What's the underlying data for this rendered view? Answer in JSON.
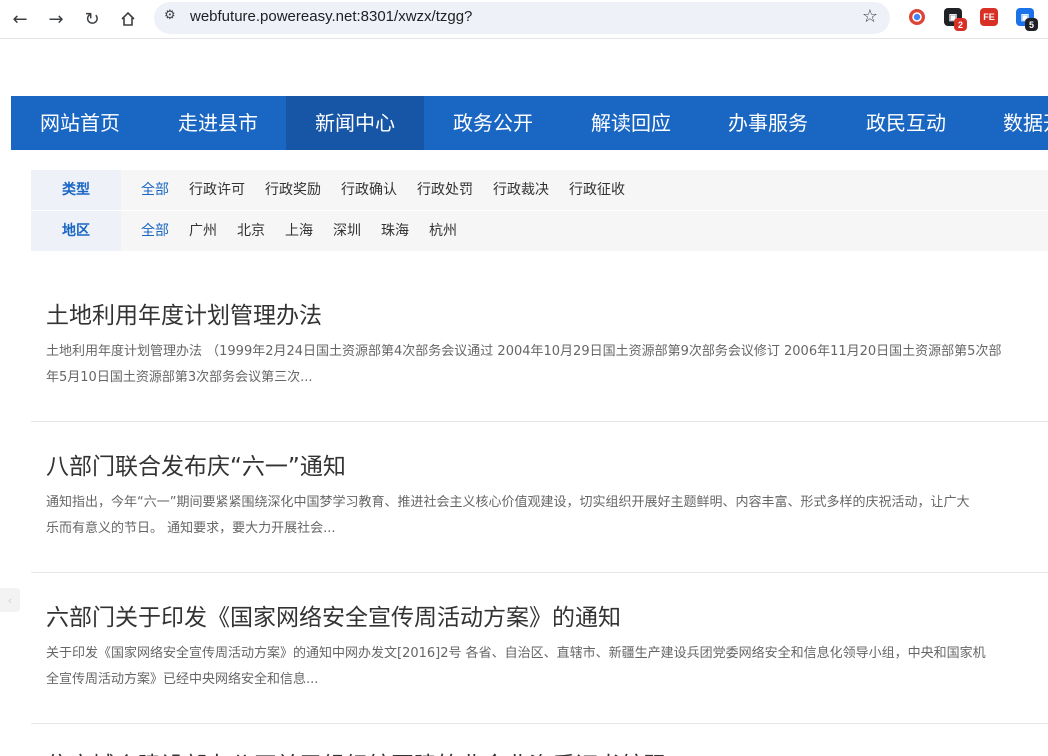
{
  "browser": {
    "url": "webfuture.powereasy.net:8301/xwzx/tzgg?",
    "extensions": [
      {
        "name": "chrome-extension-icon",
        "label": "",
        "color": "#db4437"
      },
      {
        "name": "extension-badge-2-icon",
        "label": "",
        "color": "#202124",
        "badge": "2",
        "badge_color": "#d93025"
      },
      {
        "name": "fe-extension-icon",
        "label": "FE",
        "color": "#d93025"
      },
      {
        "name": "extension-badge-5-icon",
        "label": "",
        "color": "#1a73e8",
        "badge": "5",
        "badge_color": "#202124"
      }
    ]
  },
  "nav": {
    "items": [
      "网站首页",
      "走进县市",
      "新闻中心",
      "政务公开",
      "解读回应",
      "办事服务",
      "政民互动",
      "数据开放"
    ],
    "active_index": 2
  },
  "filters": {
    "type": {
      "label": "类型",
      "options": [
        "全部",
        "行政许可",
        "行政奖励",
        "行政确认",
        "行政处罚",
        "行政裁决",
        "行政征收"
      ],
      "selected_index": 0
    },
    "region": {
      "label": "地区",
      "options": [
        "全部",
        "广州",
        "北京",
        "上海",
        "深圳",
        "珠海",
        "杭州"
      ],
      "selected_index": 0
    }
  },
  "articles": [
    {
      "title": "土地利用年度计划管理办法",
      "summary_line1": "土地利用年度计划管理办法 （1999年2月24日国土资源部第4次部务会议通过 2004年10月29日国土资源部第9次部务会议修订 2006年11月20日国土资源部第5次部",
      "summary_line2": "年5月10日国土资源部第3次部务会议第三次..."
    },
    {
      "title": "八部门联合发布庆“六一”通知",
      "summary_line1": "通知指出，今年“六一”期间要紧紧围绕深化中国梦学习教育、推进社会主义核心价值观建设，切实组织开展好主题鲜明、内容丰富、形式多样的庆祝活动，让广大",
      "summary_line2": "乐而有意义的节日。 通知要求，要大力开展社会..."
    },
    {
      "title": "六部门关于印发《国家网络安全宣传周活动方案》的通知",
      "summary_line1": "关于印发《国家网络安全宣传周活动方案》的通知中网办发文[2016]2号 各省、自治区、直辖市、新疆生产建设兵团党委网络安全和信息化领导小组，中央和国家机",
      "summary_line2": "全宣传周活动方案》已经中央网络安全和信息..."
    },
    {
      "title": "住房城乡建设部办公厅关于组织编写建筑业企业资质证书编码",
      "summary_line1": "",
      "summary_line2": ""
    }
  ],
  "colors": {
    "accent": "#1a66c3",
    "nav_active": "#1755a6"
  }
}
